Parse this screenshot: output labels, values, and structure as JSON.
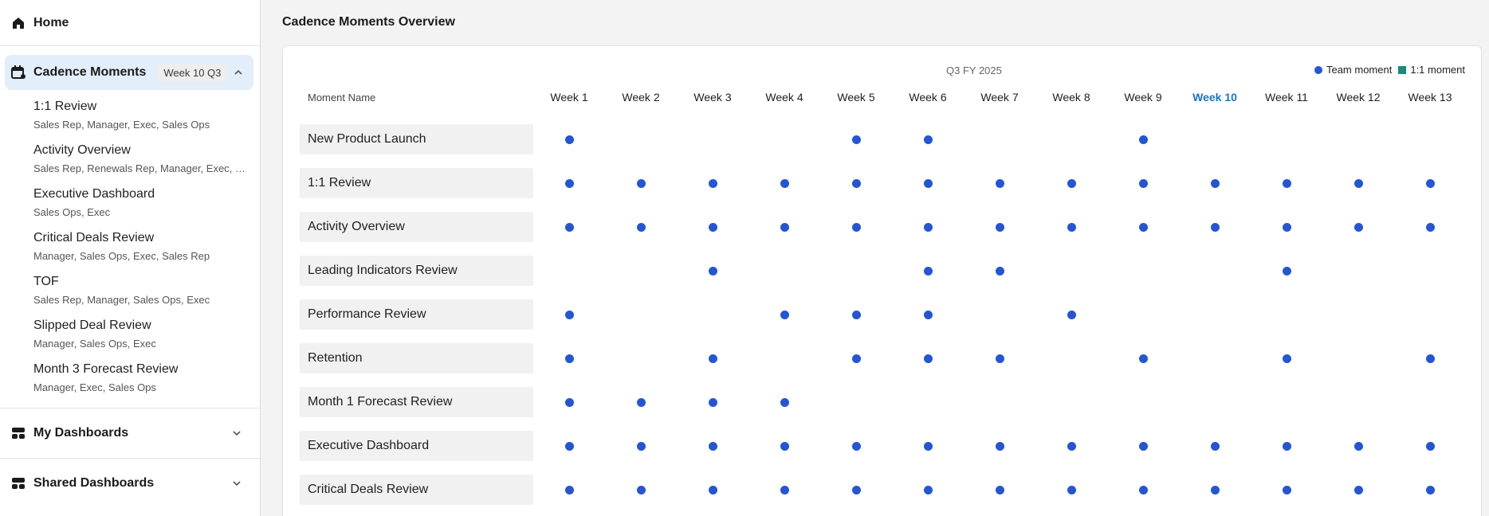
{
  "sidebar": {
    "home_label": "Home",
    "cadence": {
      "label": "Cadence Moments",
      "badge": "Week 10 Q3",
      "items": [
        {
          "title": "1:1 Review",
          "roles": "Sales Rep, Manager, Exec, Sales Ops"
        },
        {
          "title": "Activity Overview",
          "roles": "Sales Rep, Renewals Rep, Manager, Exec, Sales Ops"
        },
        {
          "title": "Executive Dashboard",
          "roles": "Sales Ops, Exec"
        },
        {
          "title": "Critical Deals Review",
          "roles": "Manager, Sales Ops, Exec, Sales Rep"
        },
        {
          "title": "TOF",
          "roles": "Sales Rep, Manager, Sales Ops, Exec"
        },
        {
          "title": "Slipped Deal Review",
          "roles": "Manager, Sales Ops, Exec"
        },
        {
          "title": "Month 3 Forecast Review",
          "roles": "Manager, Exec, Sales Ops"
        }
      ]
    },
    "my_dashboards_label": "My Dashboards",
    "shared_dashboards_label": "Shared Dashboards"
  },
  "main": {
    "title": "Cadence Moments Overview",
    "period": "Q3 FY 2025",
    "legend": {
      "team": "Team moment",
      "one_on_one": "1:1 moment"
    },
    "name_header": "Moment Name",
    "current_week_index": 9,
    "weeks": [
      "Week 1",
      "Week 2",
      "Week 3",
      "Week 4",
      "Week 5",
      "Week 6",
      "Week 7",
      "Week 8",
      "Week 9",
      "Week 10",
      "Week 11",
      "Week 12",
      "Week 13"
    ],
    "rows": [
      {
        "name": "New Product Launch",
        "weeks": [
          1,
          5,
          6,
          9
        ]
      },
      {
        "name": "1:1 Review",
        "weeks": [
          1,
          2,
          3,
          4,
          5,
          6,
          7,
          8,
          9,
          10,
          11,
          12,
          13
        ]
      },
      {
        "name": "Activity Overview",
        "weeks": [
          1,
          2,
          3,
          4,
          5,
          6,
          7,
          8,
          9,
          10,
          11,
          12,
          13
        ]
      },
      {
        "name": "Leading Indicators Review",
        "weeks": [
          3,
          6,
          7,
          11
        ]
      },
      {
        "name": "Performance Review",
        "weeks": [
          1,
          4,
          5,
          6,
          8
        ]
      },
      {
        "name": "Retention",
        "weeks": [
          1,
          3,
          5,
          6,
          7,
          9,
          11,
          13
        ]
      },
      {
        "name": "Month 1 Forecast Review",
        "weeks": [
          1,
          2,
          3,
          4
        ]
      },
      {
        "name": "Executive Dashboard",
        "weeks": [
          1,
          2,
          3,
          4,
          5,
          6,
          7,
          8,
          9,
          10,
          11,
          12,
          13
        ]
      },
      {
        "name": "Critical Deals Review",
        "weeks": [
          1,
          2,
          3,
          4,
          5,
          6,
          7,
          8,
          9,
          10,
          11,
          12,
          13
        ]
      }
    ]
  },
  "colors": {
    "team_dot": "#2455d4",
    "one_on_one": "#1a8a7c",
    "current_week": "#1a73c9",
    "active_section": "#e3eefb"
  },
  "icons": {
    "home": "home-icon",
    "cadence": "calendar-icon",
    "dashboards": "dashboard-icon",
    "chevron_up": "chevron-up-icon",
    "chevron_down": "chevron-down-icon"
  }
}
